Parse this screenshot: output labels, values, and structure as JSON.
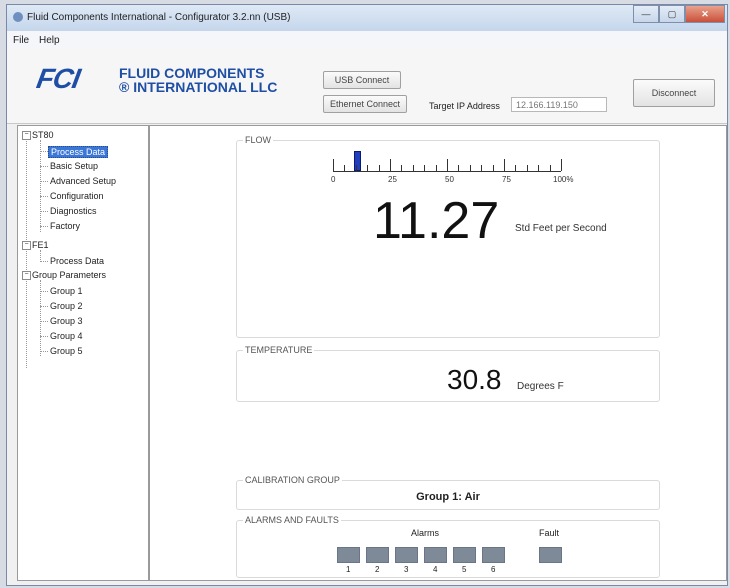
{
  "window": {
    "title": "Fluid Components International - Configurator 3.2.nn (USB)",
    "minimize": "—",
    "maximize": "▢",
    "close": "✕"
  },
  "menu": {
    "file": "File",
    "help": "Help"
  },
  "header": {
    "logo_mark": "FCI",
    "logo_line1": "FLUID COMPONENTS",
    "logo_line2": "® INTERNATIONAL LLC",
    "usb_connect": "USB Connect",
    "ethernet_connect": "Ethernet Connect",
    "ip_label": "Target IP Address",
    "ip_value": "12.166.119.150",
    "disconnect": "Disconnect"
  },
  "tree": {
    "st80": "ST80",
    "st80_items": [
      "Process Data",
      "Basic Setup",
      "Advanced Setup",
      "Configuration",
      "Diagnostics",
      "Factory"
    ],
    "fe1": "FE1",
    "fe1_items": [
      "Process Data"
    ],
    "group_params": "Group Parameters",
    "group_items": [
      "Group 1",
      "Group 2",
      "Group 3",
      "Group 4",
      "Group 5"
    ]
  },
  "flow": {
    "label": "FLOW",
    "scale_labels": [
      "0",
      "25",
      "50",
      "75",
      "100%"
    ],
    "indicator_percent": 10,
    "value": "11.27",
    "unit": "Std Feet per Second"
  },
  "temperature": {
    "label": "TEMPERATURE",
    "value": "30.8",
    "unit": "Degrees F"
  },
  "calibration": {
    "label": "CALIBRATION GROUP",
    "value": "Group 1: Air"
  },
  "alarms": {
    "label": "ALARMS AND FAULTS",
    "alarms_label": "Alarms",
    "fault_label": "Fault",
    "numbers": [
      "1",
      "2",
      "3",
      "4",
      "5",
      "6"
    ]
  },
  "colors": {
    "accent": "#1f4fa5",
    "selection": "#3b77d6",
    "indicator": "#1f3fbf",
    "alarm_off": "#7f8a99"
  }
}
